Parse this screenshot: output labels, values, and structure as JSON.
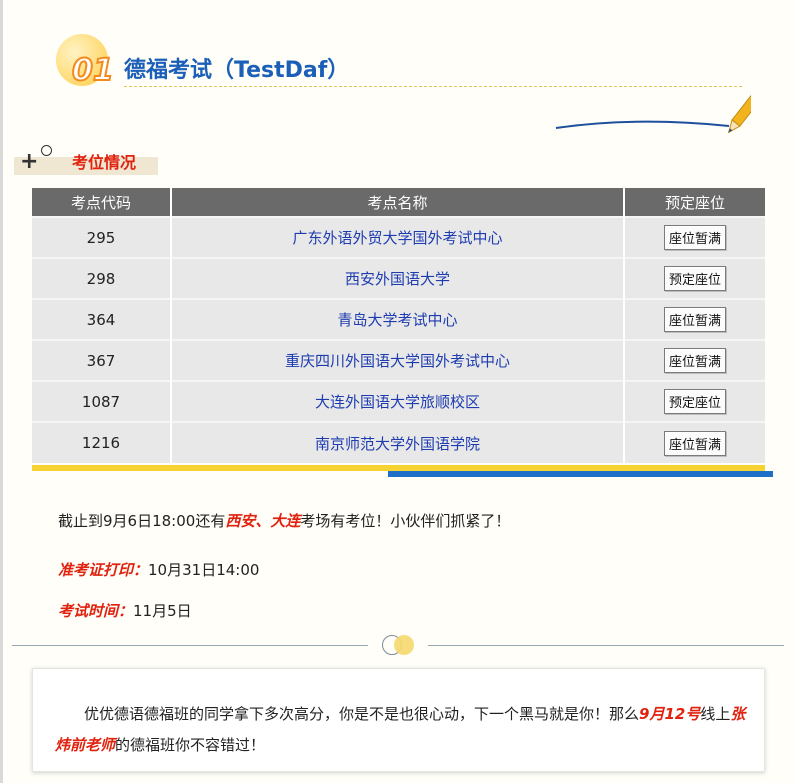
{
  "header": {
    "number": "01",
    "title": "德福考试（TestDaf）"
  },
  "section": {
    "label": "考位情况"
  },
  "table": {
    "columns": [
      "考点代码",
      "考点名称",
      "预定座位"
    ],
    "rows": [
      {
        "code": "295",
        "name": "广东外语外贸大学国外考试中心",
        "status": "座位暂满"
      },
      {
        "code": "298",
        "name": "西安外国语大学",
        "status": "预定座位"
      },
      {
        "code": "364",
        "name": "青岛大学考试中心",
        "status": "座位暂满"
      },
      {
        "code": "367",
        "name": "重庆四川外国语大学国外考试中心",
        "status": "座位暂满"
      },
      {
        "code": "1087",
        "name": "大连外国语大学旅顺校区",
        "status": "预定座位"
      },
      {
        "code": "1216",
        "name": "南京师范大学外国语学院",
        "status": "座位暂满"
      }
    ]
  },
  "notes": {
    "availability_prefix": "截止到9月6日18:00还有",
    "availability_highlight": "西安、大连",
    "availability_suffix": "考场有考位！小伙伴们抓紧了！",
    "admit_label": "准考证打印：",
    "admit_value": "10月31日14:00",
    "exam_label": "考试时间：",
    "exam_value": "11月5日"
  },
  "promo": {
    "part1": "优优德语德福班的同学拿下多次高分，你是不是也很心动，下一个黑马就是你！那么",
    "highlight1": "9月12号",
    "part2": "线上",
    "highlight2": "张炜前老师",
    "part3": "的德福班你不容错过！"
  },
  "colors": {
    "title_blue": "#1b5fb8",
    "accent_red": "#e0220e",
    "link_blue": "#1e3cb0",
    "bar_yellow": "#f7d233",
    "bar_blue": "#1d6fc8",
    "header_gray": "#6a6a6a"
  },
  "icons": [
    "number-badge-icon",
    "pen-icon",
    "plus-icon",
    "circle-icon",
    "divider-dots-icon"
  ]
}
